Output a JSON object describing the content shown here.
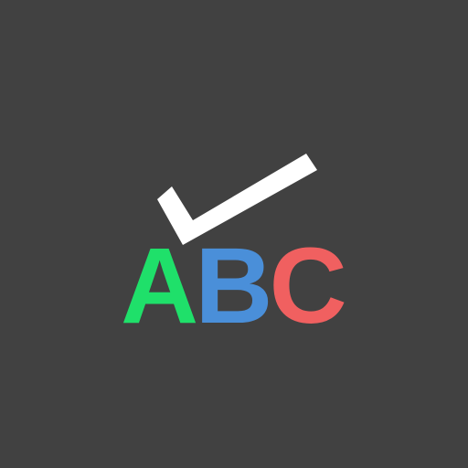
{
  "icon": {
    "background_color": "#414141",
    "check_color": "#ffffff",
    "letters": [
      {
        "char": "A",
        "color": "#1fe06a"
      },
      {
        "char": "B",
        "color": "#4a8fd9"
      },
      {
        "char": "C",
        "color": "#f06060"
      }
    ]
  }
}
